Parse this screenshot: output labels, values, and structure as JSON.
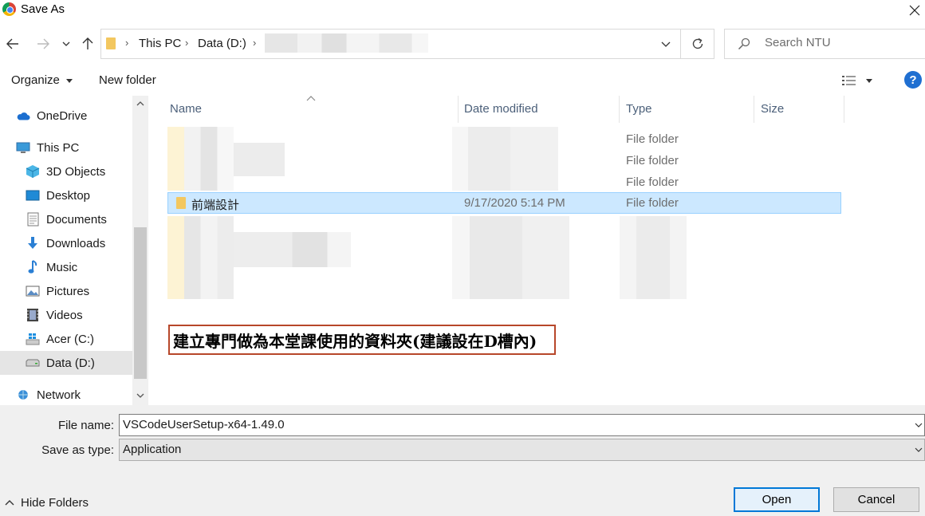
{
  "window": {
    "title": "Save As",
    "icons": {
      "app": "chrome-icon",
      "close": "close-icon"
    }
  },
  "nav": {
    "back": "back-arrow-icon",
    "forward": "forward-arrow-icon",
    "recent": "chevron-down-icon",
    "up": "up-arrow-icon"
  },
  "address": {
    "crumbs": [
      "This PC",
      "Data (D:)"
    ],
    "refresh_icon": "refresh-icon",
    "dropdown_icon": "chevron-down-icon"
  },
  "search": {
    "placeholder": "Search NTU",
    "icon": "search-icon"
  },
  "toolbar": {
    "organize": "Organize",
    "new_folder": "New folder",
    "help": "?"
  },
  "sidebar": {
    "items": [
      {
        "label": "OneDrive",
        "icon": "cloud-icon"
      },
      {
        "label": "This PC",
        "icon": "computer-icon"
      },
      {
        "label": "3D Objects",
        "icon": "cube-icon"
      },
      {
        "label": "Desktop",
        "icon": "desktop-icon"
      },
      {
        "label": "Documents",
        "icon": "document-icon"
      },
      {
        "label": "Downloads",
        "icon": "download-icon"
      },
      {
        "label": "Music",
        "icon": "music-icon"
      },
      {
        "label": "Pictures",
        "icon": "picture-icon"
      },
      {
        "label": "Videos",
        "icon": "video-icon"
      },
      {
        "label": "Acer (C:)",
        "icon": "windows-drive-icon"
      },
      {
        "label": "Data (D:)",
        "icon": "drive-icon"
      },
      {
        "label": "Network",
        "icon": "network-icon"
      }
    ]
  },
  "files": {
    "columns": {
      "name": "Name",
      "date": "Date modified",
      "type": "Type",
      "size": "Size"
    },
    "rows": [
      {
        "name": "",
        "date": "",
        "type": "File folder"
      },
      {
        "name": "",
        "date": "",
        "type": "File folder"
      },
      {
        "name": "",
        "date": "",
        "type": "File folder"
      },
      {
        "name": "前端設計",
        "date": "9/17/2020 5:14 PM",
        "type": "File folder"
      }
    ]
  },
  "annotation": {
    "text": "建立專門做為本堂課使用的資料夾(建議設在D槽內)"
  },
  "bottom": {
    "file_name_label": "File name:",
    "file_name_value": "VSCodeUserSetup-x64-1.49.0",
    "save_type_label": "Save as type:",
    "save_type_value": "Application",
    "hide_folders": "Hide Folders",
    "open": "Open",
    "cancel": "Cancel"
  },
  "colors": {
    "accent": "#0078d7",
    "selected_row": "#cce8ff",
    "annotation_border": "#b7472a",
    "folder": "#f3c75f"
  }
}
